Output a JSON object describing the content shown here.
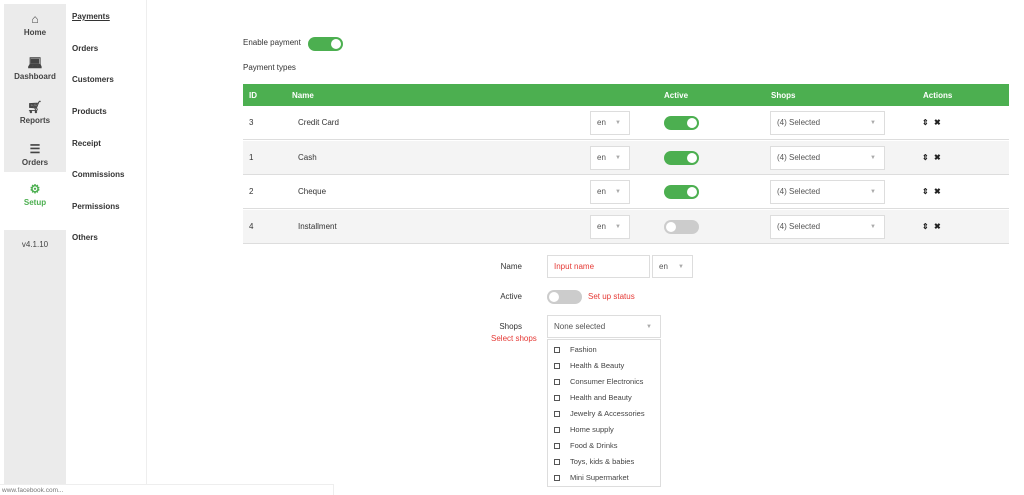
{
  "sidebar": {
    "items": [
      {
        "label": "Home",
        "icon": "home-icon"
      },
      {
        "label": "Dashboard",
        "icon": "laptop-icon"
      },
      {
        "label": "Reports",
        "icon": "cart-icon"
      },
      {
        "label": "Orders",
        "icon": "list-icon"
      },
      {
        "label": "Setup",
        "icon": "gear-icon"
      }
    ],
    "version": "v4.1.10"
  },
  "submenu": [
    "Payments",
    "Orders",
    "Customers",
    "Products",
    "Receipt",
    "Commissions",
    "Permissions",
    "Others"
  ],
  "main": {
    "enable_payment_label": "Enable payment",
    "enable_payment": true,
    "payment_types_label": "Payment types",
    "table": {
      "headers": [
        "ID",
        "Name",
        "Active",
        "Shops",
        "Actions"
      ],
      "rows": [
        {
          "id": "3",
          "name": "Credit Card",
          "lang": "en",
          "active": true,
          "shops": "(4) Selected"
        },
        {
          "id": "1",
          "name": "Cash",
          "lang": "en",
          "active": true,
          "shops": "(4) Selected"
        },
        {
          "id": "2",
          "name": "Cheque",
          "lang": "en",
          "active": true,
          "shops": "(4) Selected"
        },
        {
          "id": "4",
          "name": "Installment",
          "lang": "en",
          "active": false,
          "shops": "(4) Selected"
        }
      ]
    }
  },
  "form": {
    "name_label": "Name",
    "name_placeholder": "Input name",
    "lang": "en",
    "active_label": "Active",
    "active_hint": "Set up status",
    "shops_label": "Shops",
    "shops_hint": "Select shops",
    "shops_value": "None selected",
    "shop_options": [
      "Fashion",
      "Health & Beauty",
      "Consumer Electronics",
      "Health and Beauty",
      "Jewelry & Accessories",
      "Home supply",
      "Food & Drinks",
      "Toys, kids & babies",
      "Mini Supermarket"
    ]
  },
  "status_bar": "www.facebook.com...",
  "colors": {
    "accent": "#4caf50",
    "hint": "#e53935"
  }
}
